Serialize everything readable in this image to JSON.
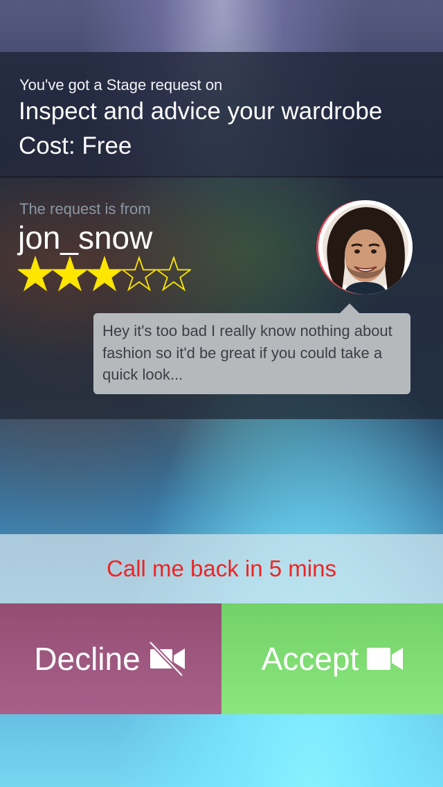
{
  "request": {
    "intro": "You've got a Stage request on",
    "title": "Inspect and advice your wardrobe",
    "cost": "Cost: Free"
  },
  "sender": {
    "from_label": "The request is from",
    "username": "jon_snow",
    "rating": 3,
    "rating_max": 5,
    "message": "Hey it's too bad I really know nothing about fashion so it'd be great if you could take a quick look..."
  },
  "actions": {
    "callback_label": "Call me back in 5 mins",
    "decline_label": "Decline",
    "accept_label": "Accept"
  },
  "icons": {
    "decline": "video-off-icon",
    "accept": "video-camera-icon",
    "filled_star": "star-filled-icon",
    "empty_star": "star-outline-icon"
  },
  "colors": {
    "star": "#ffe600",
    "callback_text": "#ee2424",
    "decline_bg": "#a05a80",
    "accept_bg": "#7fdc72"
  }
}
